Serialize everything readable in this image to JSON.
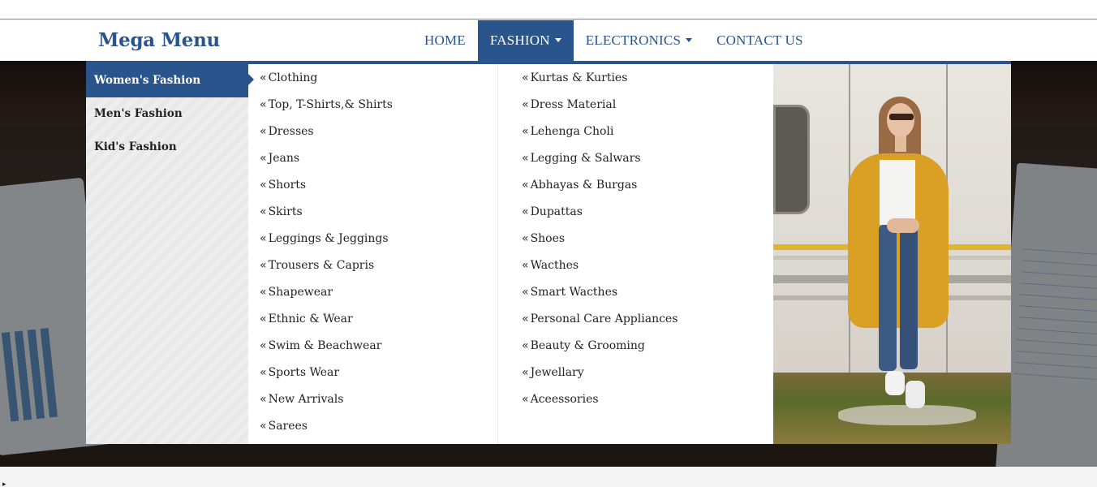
{
  "brand": "Mega Menu",
  "nav": {
    "home": "HOME",
    "fashion": "FASHION",
    "electronics": "ELECTRONICS",
    "contact": "CONTACT US"
  },
  "mega": {
    "categories": [
      "Women's Fashion",
      "Men's Fashion",
      "Kid's Fashion"
    ],
    "column1": [
      "Clothing",
      "Top, T-Shirts,& Shirts",
      "Dresses",
      "Jeans",
      "Shorts",
      "Skirts",
      "Leggings & Jeggings",
      "Trousers & Capris",
      "Shapewear",
      "Ethnic & Wear",
      "Swim & Beachwear",
      "Sports Wear",
      "New Arrivals",
      "Sarees"
    ],
    "column2": [
      "Kurtas & Kurties",
      "Dress Material",
      "Lehenga Choli",
      "Legging & Salwars",
      "Abhayas & Burgas",
      "Dupattas",
      "Shoes",
      "Wacthes",
      "Smart Wacthes",
      "Personal Care Appliances",
      "Beauty & Grooming",
      "Jewellary",
      "Aceessories"
    ],
    "link_icon": "«",
    "promo_image": "woman-in-yellow-coat-photo"
  },
  "colors": {
    "accent": "#2a558c",
    "text": "#222222"
  }
}
